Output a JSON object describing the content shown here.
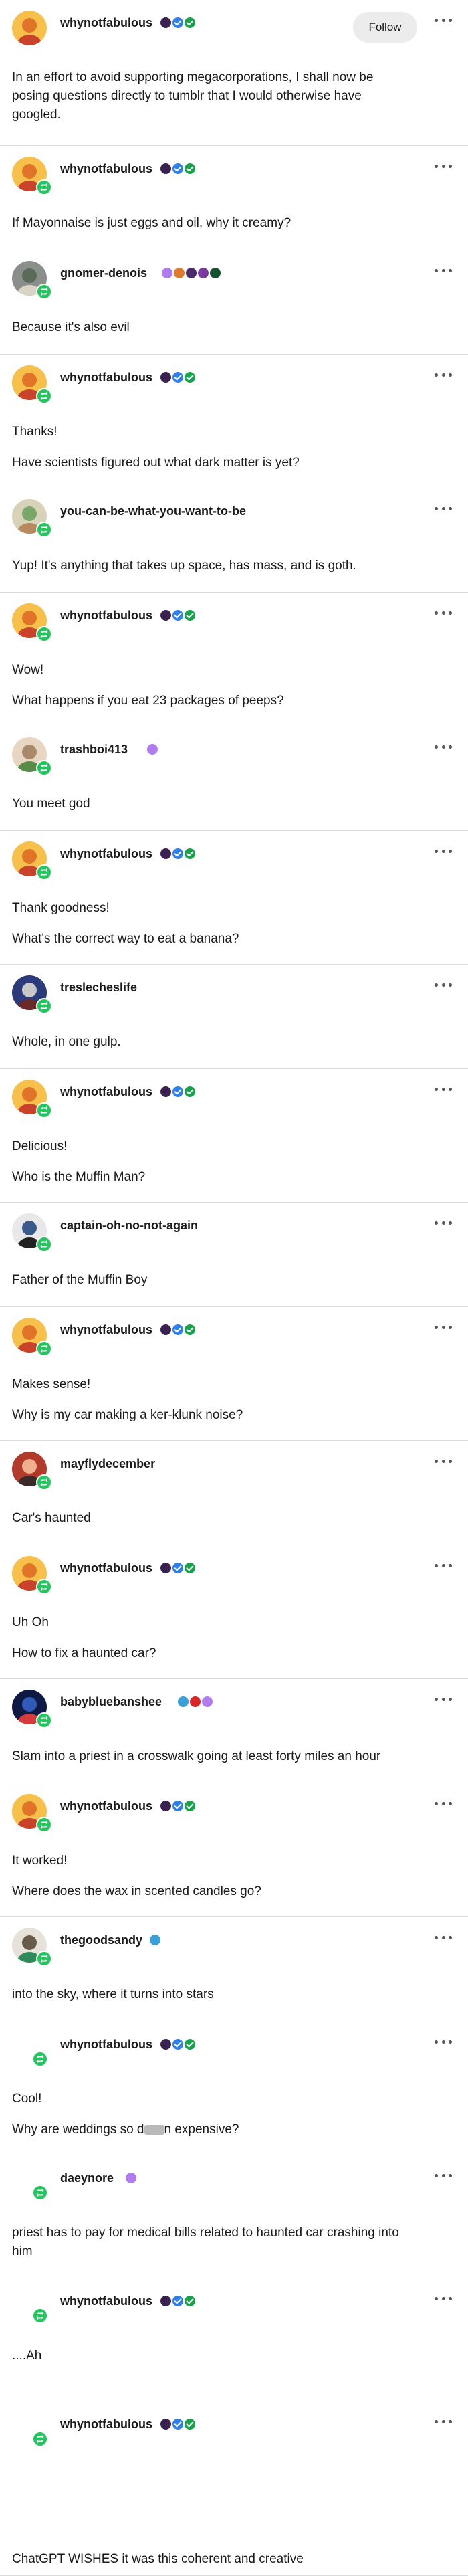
{
  "follow_label": "Follow",
  "colors": {
    "reblog": "#22c55e",
    "badge_purple": "#5b2a86",
    "badge_blue": "#2f80ed",
    "badge_green": "#16a34a"
  },
  "posts": [
    {
      "username": "whynotfabulous",
      "lines": [
        "In an effort to avoid supporting megacorporations, I shall now be",
        "posing questions directly to tumblr that I would otherwise have",
        "googled."
      ]
    },
    {
      "username": "whynotfabulous",
      "lines": [
        "If Mayonnaise is just eggs and oil, why it creamy?"
      ]
    },
    {
      "username": "gnomer-denois",
      "lines": [
        "Because it's also evil"
      ]
    },
    {
      "username": "whynotfabulous",
      "lines": [
        "Thanks!",
        "Have scientists figured out what dark matter is yet?"
      ]
    },
    {
      "username": "you-can-be-what-you-want-to-be",
      "lines": [
        "Yup! It's anything that takes up space, has mass, and is goth."
      ]
    },
    {
      "username": "whynotfabulous",
      "lines": [
        "Wow!",
        "What happens if you eat 23 packages of peeps?"
      ]
    },
    {
      "username": "trashboi413",
      "lines": [
        "You meet god"
      ]
    },
    {
      "username": "whynotfabulous",
      "lines": [
        "Thank goodness!",
        "What's the correct way to eat a banana?"
      ]
    },
    {
      "username": "treslecheslife",
      "lines": [
        "Whole, in one gulp."
      ]
    },
    {
      "username": "whynotfabulous",
      "lines": [
        "Delicious!",
        "Who is the Muffin Man?"
      ]
    },
    {
      "username": "captain-oh-no-not-again",
      "lines": [
        "Father of the Muffin Boy"
      ]
    },
    {
      "username": "whynotfabulous",
      "lines": [
        "Makes sense!",
        "Why is my car making a ker-klunk noise?"
      ]
    },
    {
      "username": "mayflydecember",
      "lines": [
        "Car's haunted"
      ]
    },
    {
      "username": "whynotfabulous",
      "lines": [
        "Uh Oh",
        "How to fix a haunted car?"
      ]
    },
    {
      "username": "babybluebanshee",
      "lines": [
        "Slam into a priest in a crosswalk going at least forty miles an hour"
      ]
    },
    {
      "username": "whynotfabulous",
      "lines": [
        "It worked!",
        "Where does the wax in scented candles go?"
      ]
    },
    {
      "username": "thegoodsandy",
      "lines": [
        "into the sky, where it turns into stars"
      ]
    },
    {
      "username": "whynotfabulous",
      "lines": [
        "Cool!",
        "Why are weddings so d",
        "n expensive?"
      ]
    },
    {
      "username": "daeynore",
      "lines": [
        "priest has to pay for medical bills related to haunted car crashing into",
        "him"
      ]
    },
    {
      "username": "whynotfabulous",
      "lines": [
        "....Ah"
      ]
    },
    {
      "username": "whynotfabulous",
      "lines": [
        "ChatGPT WISHES it was this coherent and creative"
      ]
    }
  ]
}
